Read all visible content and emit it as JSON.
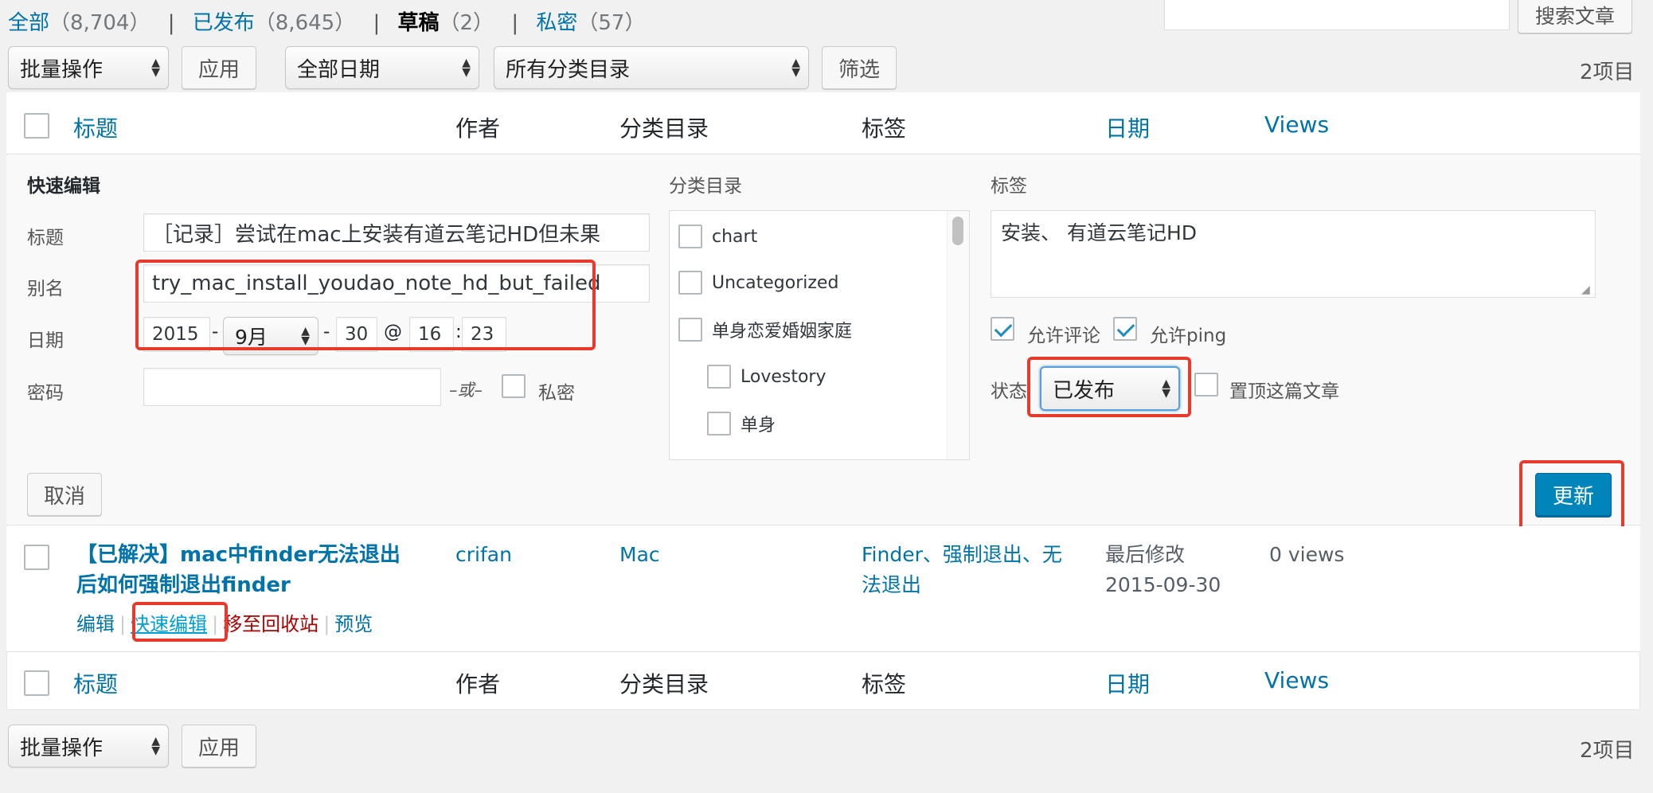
{
  "views": {
    "all": {
      "label": "全部",
      "count": "（8,704）"
    },
    "published": {
      "label": "已发布",
      "count": "（8,645）"
    },
    "draft": {
      "label": "草稿",
      "count": "（2）"
    },
    "private": {
      "label": "私密",
      "count": "（57）"
    },
    "separator": "|"
  },
  "search": {
    "button": "搜索文章",
    "value": ""
  },
  "top_nav": {
    "bulk_action": "批量操作",
    "apply": "应用",
    "date_filter": "全部日期",
    "category_filter": "所有分类目录",
    "filter": "筛选",
    "item_count": "2项目"
  },
  "columns": {
    "title": "标题",
    "author": "作者",
    "categories": "分类目录",
    "tags": "标签",
    "date": "日期",
    "views": "Views"
  },
  "quick_edit": {
    "heading": "快速编辑",
    "title_label": "标题",
    "title_value": "［记录］尝试在mac上安装有道云笔记HD但未果",
    "slug_label": "别名",
    "slug_value": "try_mac_install_youdao_note_hd_but_failed",
    "date_label": "日期",
    "year": "2015",
    "month": "9月",
    "day": "30",
    "hour": "16",
    "minute": "23",
    "dash": "-",
    "at": "@",
    "colon": ":",
    "password_label": "密码",
    "or": "–或–",
    "private_label": "私密",
    "categories_heading": "分类目录",
    "categories": [
      {
        "label": "chart",
        "indent": false
      },
      {
        "label": "Uncategorized",
        "indent": false
      },
      {
        "label": "单身恋爱婚姻家庭",
        "indent": false
      },
      {
        "label": "Lovestory",
        "indent": true
      },
      {
        "label": "单身",
        "indent": true
      }
    ],
    "tags_heading": "标签",
    "tags_value": "安装、 有道云笔记HD",
    "allow_comments": "允许评论",
    "allow_ping": "允许ping",
    "status_label": "状态",
    "status_value": "已发布",
    "sticky_label": "置顶这篇文章",
    "cancel": "取消",
    "update": "更新"
  },
  "post_row": {
    "title_line1": "【已解决】mac中finder无法退出",
    "title_line2": "后如何强制退出finder",
    "author": "crifan",
    "category": "Mac",
    "tags_line1": "Finder、强制退出、无",
    "tags_line2": "法退出",
    "date_status": "最后修改",
    "date_value": "2015-09-30",
    "views": "0 views",
    "actions": {
      "edit": "编辑",
      "quick_edit": "快速编辑",
      "trash": "移至回收站",
      "preview": "预览",
      "sep": "|"
    }
  },
  "bottom_nav": {
    "bulk_action": "批量操作",
    "apply": "应用",
    "item_count": "2项目"
  },
  "colors": {
    "link": "#0073aa",
    "highlight": "#e8392d",
    "primary": "#0085ba",
    "trash": "#aa0000"
  }
}
